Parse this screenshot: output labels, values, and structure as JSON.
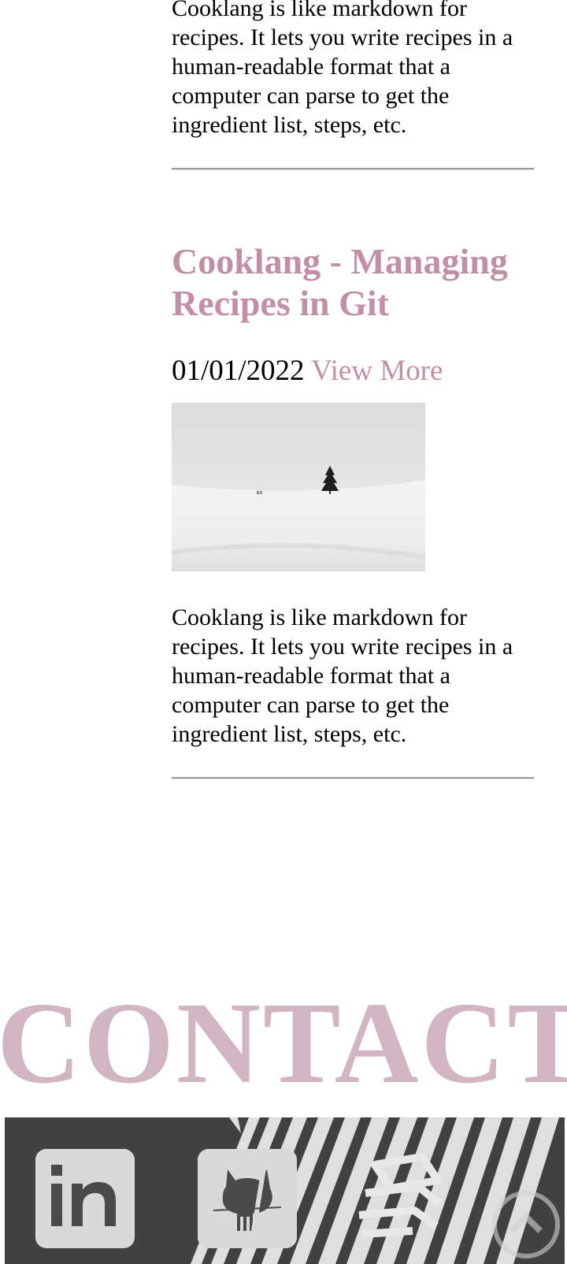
{
  "posts": [
    {
      "excerpt": "Cooklang is like markdown for recipes. It lets you write recipes in a human-readable format that a computer can parse to get the ingredient list, steps, etc."
    },
    {
      "title": "Cooklang - Managing Recipes in Git",
      "date": "01/01/2022",
      "view_more": "View More",
      "thumbnail_alt": "snowy field with single pine tree",
      "excerpt": "Cooklang is like markdown for recipes. It lets you write recipes in a human-readable format that a computer can parse to get the ingredient list, steps, etc."
    }
  ],
  "contact": {
    "heading": "CONTACT",
    "links": [
      {
        "icon": "linkedin-icon",
        "label": "in"
      },
      {
        "icon": "github-icon"
      },
      {
        "icon": "stack-overflow-icon"
      },
      {
        "icon": "scroll-to-top-icon"
      }
    ]
  },
  "colors": {
    "accent": "#c290a6",
    "contact_heading": "#d2b5c2",
    "rule": "#9a9a9a",
    "banner_dark": "#4a4a4a",
    "tile": "#d8d8d8"
  }
}
